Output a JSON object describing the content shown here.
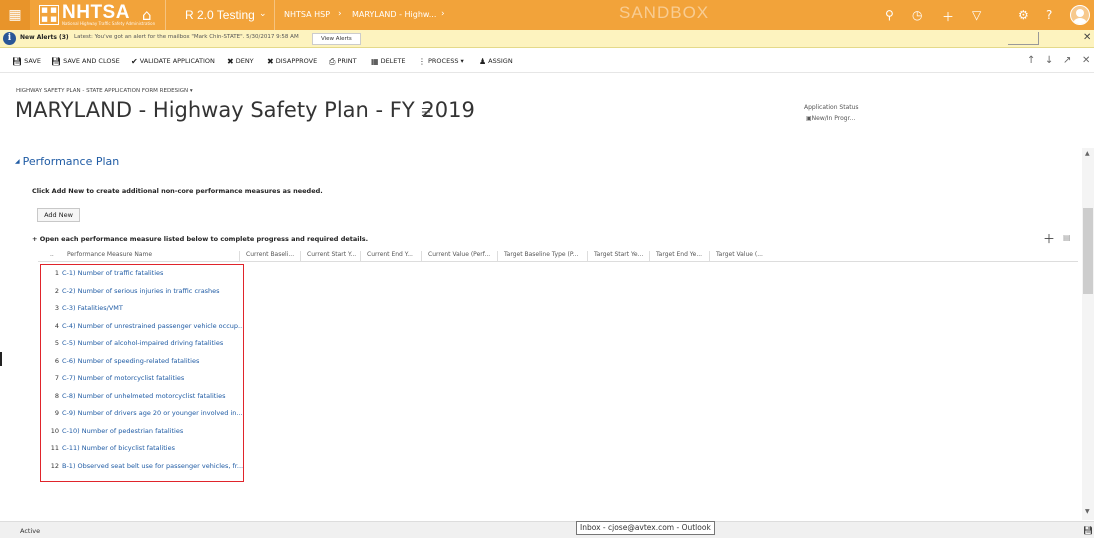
{
  "topbar": {
    "logo_text": "NHTSA",
    "logo_sub": "National Highway Traffic Safety Administration",
    "environment": "R 2.0 Testing",
    "breadcrumb_app": "NHTSA HSP",
    "breadcrumb_record": "MARYLAND - Highw...",
    "watermark": "SANDBOX",
    "colors": {
      "nav_bg": "#f2a33a",
      "link": "#1f5ba4",
      "highlight": "#e0242b"
    }
  },
  "alerts": {
    "title": "New Alerts (3)",
    "message": "Latest: You've got an alert for the mailbox \"Mark Chin-STATE\". 5/30/2017 9:58 AM",
    "button": "View Alerts"
  },
  "commands": {
    "save": "SAVE",
    "save_close": "SAVE AND CLOSE",
    "validate": "VALIDATE APPLICATION",
    "deny": "DENY",
    "disapprove": "DISAPPROVE",
    "print": "PRINT",
    "delete": "DELETE",
    "process": "PROCESS",
    "assign": "ASSIGN"
  },
  "header": {
    "form_selector": "HIGHWAY SAFETY PLAN - STATE APPLICATION FORM REDESIGN",
    "title": "MARYLAND - Highway Safety Plan - FY 2019",
    "status_label": "Application Status",
    "status_value": "New/In Progr..."
  },
  "section": {
    "title": "Performance Plan",
    "hint_add": "Click Add New to create additional non-core performance measures as needed.",
    "add_button": "Add New",
    "hint_open": "+ Open each performance measure listed below to complete progress and required details."
  },
  "grid": {
    "columns": [
      "Performance Measure Name",
      "Current Baseli...",
      "Current Start Y...",
      "Current End Y...",
      "Current Value (Perf...",
      "Target Baseline Type (P...",
      "Target Start Ye...",
      "Target End Ye...",
      "Target Value (..."
    ],
    "rows": [
      {
        "num": "1",
        "name": "C-1) Number of traffic fatalities"
      },
      {
        "num": "2",
        "name": "C-2) Number of serious injuries in traffic crashes"
      },
      {
        "num": "3",
        "name": "C-3) Fatalities/VMT"
      },
      {
        "num": "4",
        "name": "C-4) Number of unrestrained passenger vehicle occup..."
      },
      {
        "num": "5",
        "name": "C-5) Number of alcohol-impaired driving fatalities"
      },
      {
        "num": "6",
        "name": "C-6) Number of speeding-related fatalities"
      },
      {
        "num": "7",
        "name": "C-7) Number of motorcyclist fatalities"
      },
      {
        "num": "8",
        "name": "C-8) Number of unhelmeted motorcyclist fatalities"
      },
      {
        "num": "9",
        "name": "C-9) Number of drivers age 20 or younger involved in..."
      },
      {
        "num": "10",
        "name": "C-10) Number of pedestrian fatalities"
      },
      {
        "num": "11",
        "name": "C-11) Number of bicyclist fatalities"
      },
      {
        "num": "12",
        "name": "B-1) Observed seat belt use for passenger vehicles, fr..."
      }
    ]
  },
  "statusbar": {
    "state": "Active",
    "tooltip": "Inbox - cjose@avtex.com - Outlook"
  }
}
